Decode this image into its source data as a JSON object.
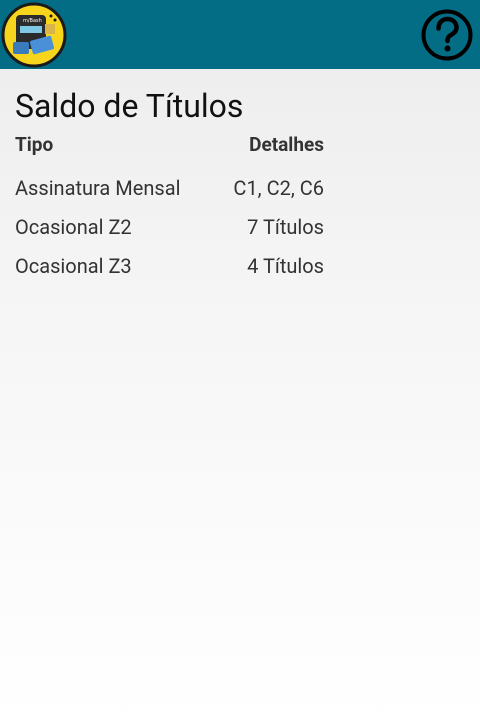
{
  "header": {
    "logo_icon": "card-reader-logo-icon",
    "logo_text": "m/Bash",
    "help_icon": "question-mark-circle-icon",
    "bar_color": "#036d86"
  },
  "page": {
    "title": "Saldo de Títulos"
  },
  "table": {
    "columns": [
      "Tipo",
      "Detalhes"
    ],
    "rows": [
      {
        "tipo": "Assinatura Mensal",
        "detalhes": "C1, C2, C6"
      },
      {
        "tipo": "Ocasional Z2",
        "detalhes": "7 Títulos"
      },
      {
        "tipo": "Ocasional Z3",
        "detalhes": "4 Títulos"
      }
    ]
  }
}
